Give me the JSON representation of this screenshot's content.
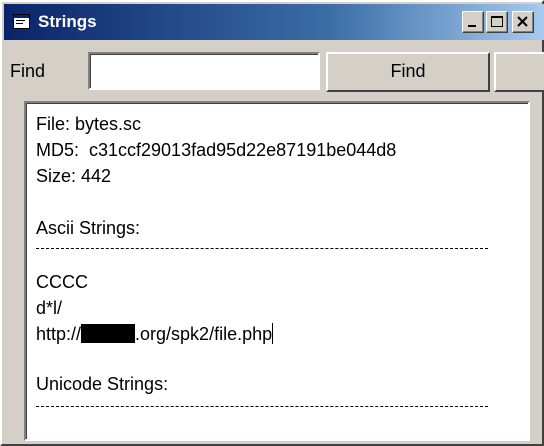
{
  "window": {
    "title": "Strings",
    "icon": "app-window-icon",
    "controls": {
      "minimize": "minimize-icon",
      "maximize": "maximize-icon",
      "close": "close-icon"
    }
  },
  "find": {
    "label": "Find",
    "input_value": "",
    "button_label": "Find"
  },
  "output": {
    "file_line": "File: bytes.sc",
    "md5_line": "MD5:  c31ccf29013fad95d22e87191be044d8",
    "size_line": "Size: 442",
    "ascii_header": "Ascii Strings:",
    "ascii_strings": [
      "CCCC",
      "d*l/"
    ],
    "url_prefix": "http://",
    "url_suffix": ".org/spk2/file.php",
    "unicode_header": "Unicode Strings:"
  },
  "colors": {
    "titlebar_start": "#0a246a",
    "titlebar_end": "#a6caf0",
    "window_face": "#d4d0c8"
  }
}
